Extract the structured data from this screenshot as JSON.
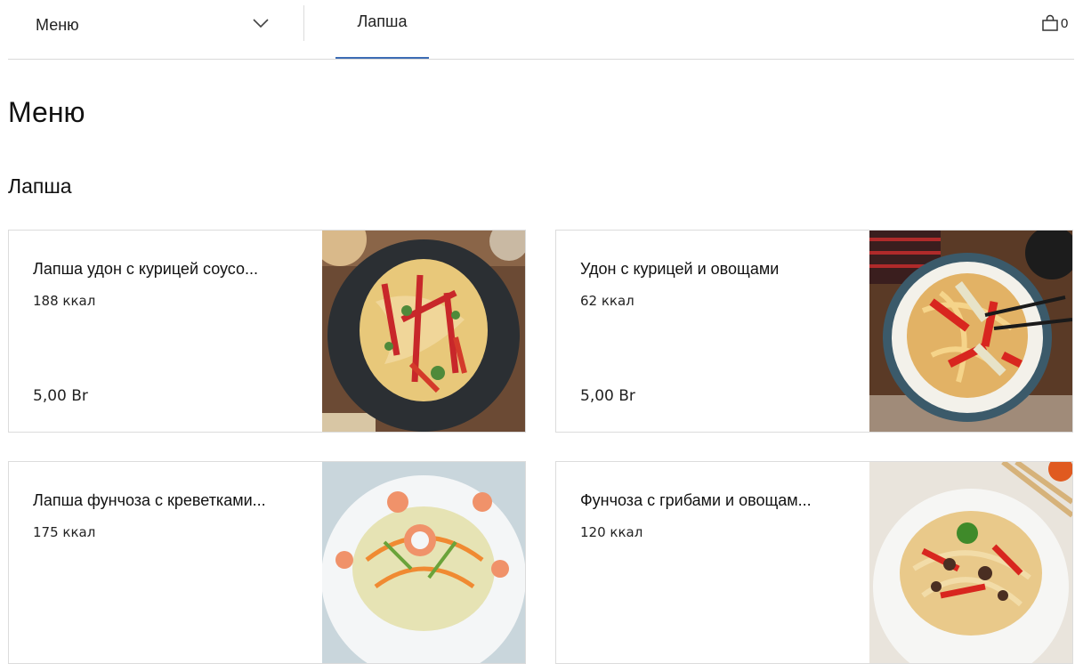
{
  "header": {
    "menu_dropdown_label": "Меню",
    "active_tab_label": "Лапша",
    "cart_count": "0"
  },
  "page": {
    "title": "Меню",
    "section_title": "Лапша"
  },
  "products": [
    {
      "name": "Лапша удон с курицей соусо...",
      "kcal": "188 ккал",
      "price": "5,00 Br",
      "image_icon": "noodles-dark-plate-image"
    },
    {
      "name": "Удон с курицей и овощами",
      "kcal": "62 ккал",
      "price": "5,00 Br",
      "image_icon": "udon-bowl-image"
    },
    {
      "name": "Лапша фунчоза с креветками...",
      "kcal": "175 ккал",
      "price": "",
      "image_icon": "funchoza-shrimp-image"
    },
    {
      "name": "Фунчоза с грибами и овощам...",
      "kcal": "120 ккал",
      "price": "",
      "image_icon": "funchoza-mushroom-image"
    }
  ],
  "colors": {
    "accent": "#3d6db5",
    "divider": "#d9d9d9",
    "card_border": "#dcdcdc"
  }
}
